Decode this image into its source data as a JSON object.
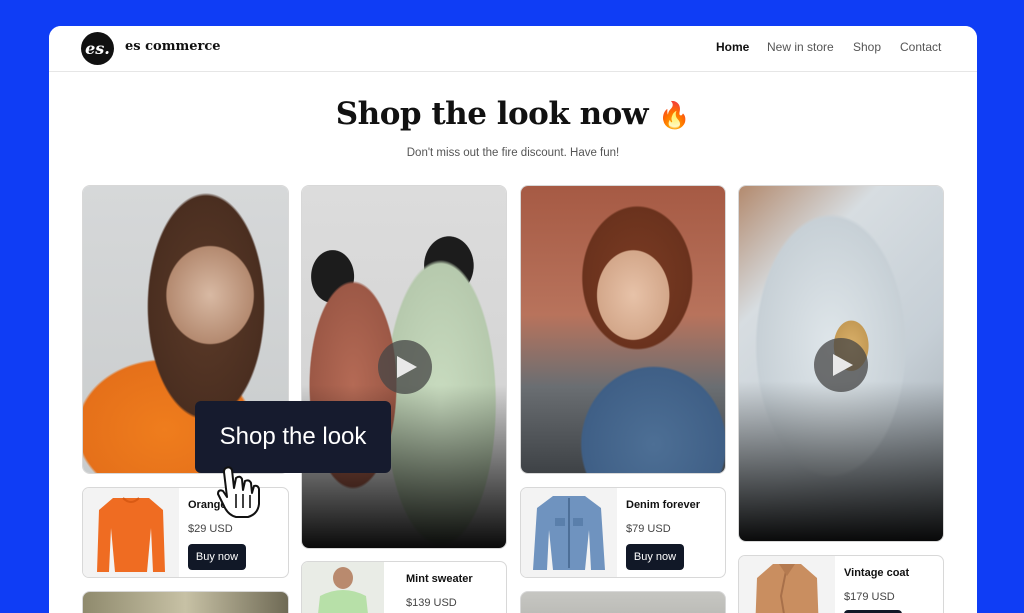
{
  "brand": {
    "mark": "es.",
    "name": "es commerce"
  },
  "nav": {
    "home": "Home",
    "new_in_store": "New in store",
    "shop": "Shop",
    "contact": "Contact"
  },
  "hero": {
    "title": "Shop the look now",
    "emoji": "🔥",
    "subtitle": "Don't miss out the fire discount. Have fun!"
  },
  "tooltip": {
    "label": "Shop the look"
  },
  "products": [
    {
      "name": "Orange",
      "price": "$29 USD",
      "button": "Buy now"
    },
    {
      "name": "Mint sweater",
      "price": "$139 USD"
    },
    {
      "name": "Denim forever",
      "price": "$79 USD",
      "button": "Buy now"
    },
    {
      "name": "Vintage coat",
      "price": "$179 USD"
    }
  ],
  "colors": {
    "background": "#0f3df5",
    "button": "#111827",
    "tooltip": "#161b2e"
  }
}
